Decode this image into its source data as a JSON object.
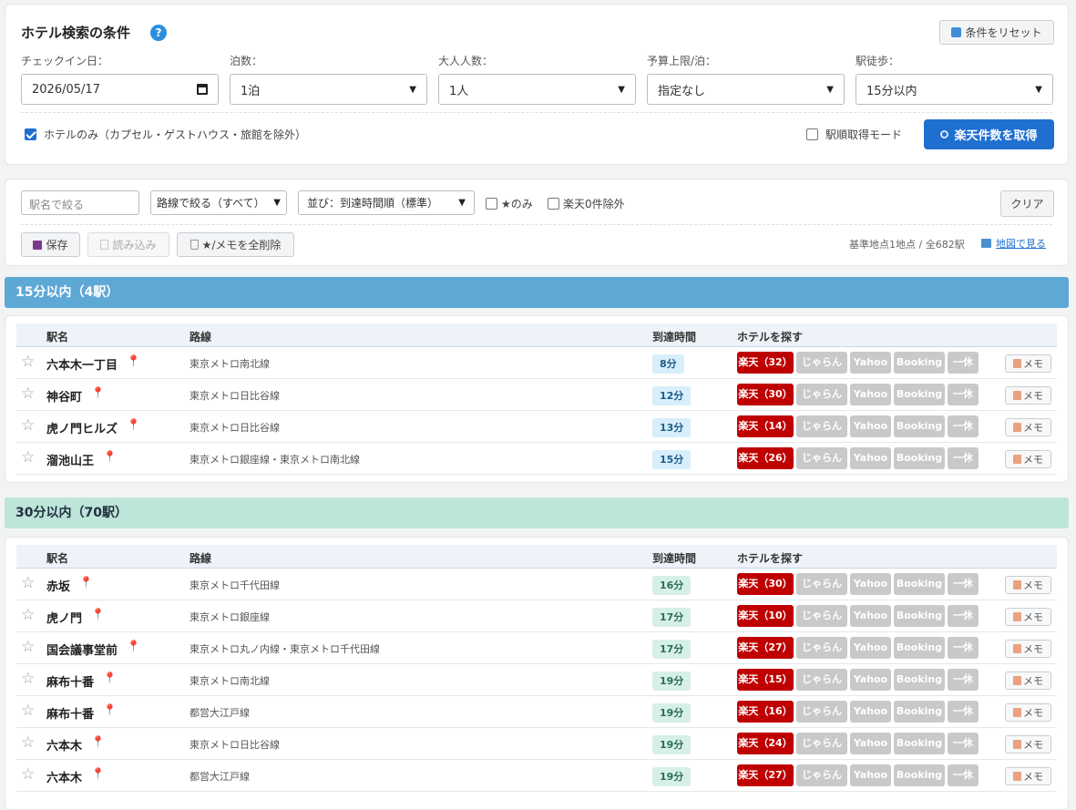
{
  "conditions": {
    "title": "ホテル検索の条件",
    "help_icon": "?",
    "reset_label": "条件をリセット",
    "checkin": {
      "label": "チェックイン日：",
      "value": "2026/05/17"
    },
    "nights": {
      "label": "泊数：",
      "value": "1泊"
    },
    "adults": {
      "label": "大人人数：",
      "value": "1人"
    },
    "budget": {
      "label": "予算上限/泊：",
      "value": "指定なし"
    },
    "walk": {
      "label": "駅徒歩：",
      "value": "15分以内"
    },
    "hotel_only_label": "ホテルのみ（カプセル・ゲストハウス・旅館を除外）",
    "hotel_only_checked": true,
    "station_order_label": "駅順取得モード",
    "station_order_checked": false,
    "fetch_label": "楽天件数を取得"
  },
  "filters": {
    "station_placeholder": "駅名で絞る",
    "line_filter": "路線で絞る（すべて）",
    "sort": "並び：到達時間順（標準）",
    "star_only_label": "★のみ",
    "exclude_zero_label": "楽天0件除外",
    "clear_label": "クリア",
    "save_label": "保存",
    "load_label": "読み込み",
    "delete_all_label": "★/メモを全削除",
    "summary": "基準地点1地点 / 全682駅",
    "map_label": "地図で見る"
  },
  "table_headers": {
    "station": "駅名",
    "line": "路線",
    "time": "到達時間",
    "hotels": "ホテルを探す"
  },
  "buttons": {
    "jalan": "じゃらん",
    "yahoo": "Yahoo",
    "booking": "Booking",
    "ikyu": "一休",
    "memo": "メモ"
  },
  "colors": {
    "accent": "#1f6fd1",
    "rakuten": "#bf0000",
    "group15": "#5ea8d6",
    "group30": "#bde5d9"
  },
  "groups": [
    {
      "label": "15分以内（4駅）",
      "rows": [
        {
          "station": "六本木一丁目",
          "line": "東京メトロ南北線",
          "time": "8分",
          "rakuten": "楽天（32）"
        },
        {
          "station": "神谷町",
          "line": "東京メトロ日比谷線",
          "time": "12分",
          "rakuten": "楽天（30）"
        },
        {
          "station": "虎ノ門ヒルズ",
          "line": "東京メトロ日比谷線",
          "time": "13分",
          "rakuten": "楽天（14）"
        },
        {
          "station": "溜池山王",
          "line": "東京メトロ銀座線・東京メトロ南北線",
          "time": "15分",
          "rakuten": "楽天（26）"
        }
      ]
    },
    {
      "label": "30分以内（70駅）",
      "rows": [
        {
          "station": "赤坂",
          "line": "東京メトロ千代田線",
          "time": "16分",
          "rakuten": "楽天（30）"
        },
        {
          "station": "虎ノ門",
          "line": "東京メトロ銀座線",
          "time": "17分",
          "rakuten": "楽天（10）"
        },
        {
          "station": "国会議事堂前",
          "line": "東京メトロ丸ノ内線・東京メトロ千代田線",
          "time": "17分",
          "rakuten": "楽天（27）"
        },
        {
          "station": "麻布十番",
          "line": "東京メトロ南北線",
          "time": "19分",
          "rakuten": "楽天（15）"
        },
        {
          "station": "麻布十番",
          "line": "都営大江戸線",
          "time": "19分",
          "rakuten": "楽天（16）"
        },
        {
          "station": "六本木",
          "line": "東京メトロ日比谷線",
          "time": "19分",
          "rakuten": "楽天（24）"
        },
        {
          "station": "六本木",
          "line": "都営大江戸線",
          "time": "19分",
          "rakuten": "楽天（27）"
        }
      ]
    }
  ]
}
